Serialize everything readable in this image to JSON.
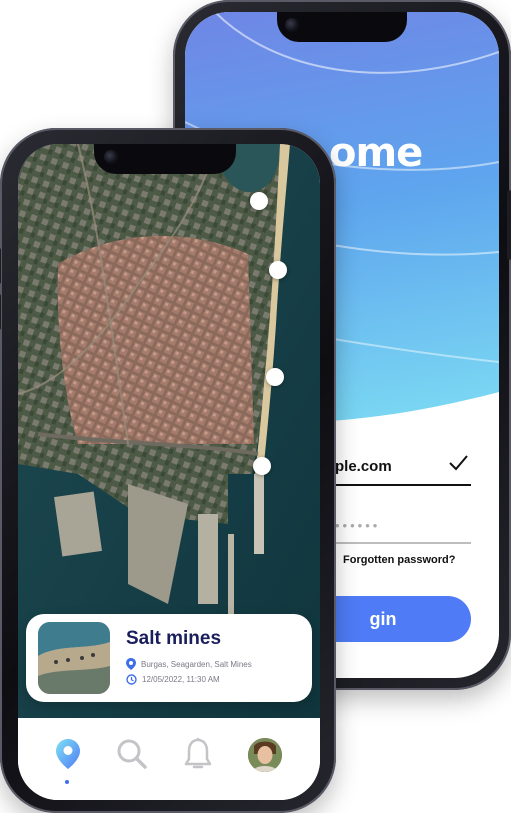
{
  "login_screen": {
    "welcome_partial": "ome",
    "email_partial": "ple.com",
    "password_mask": "••••••",
    "forgot_password": "Forgotten password?",
    "login_partial": "gin"
  },
  "map_screen": {
    "place_card": {
      "title": "Salt mines",
      "location": "Burgas, Seagarden, Salt Mines",
      "datetime": "12/05/2022, 11:30 AM"
    },
    "nav": {
      "items": [
        "location-icon",
        "search-icon",
        "bell-icon",
        "avatar"
      ],
      "active": "location-icon"
    }
  },
  "colors": {
    "accent": "#4f7cf6",
    "title_navy": "#1a1f5c",
    "hero_top": "#6f86e6",
    "hero_bottom": "#7fe0f3"
  }
}
